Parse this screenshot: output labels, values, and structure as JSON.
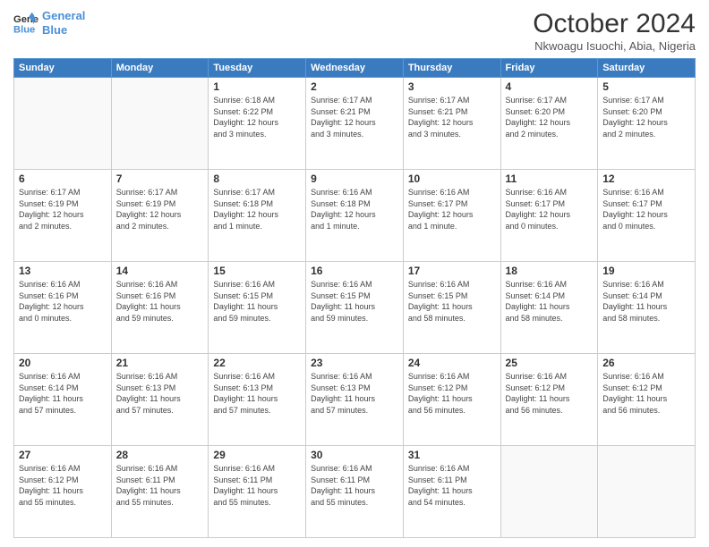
{
  "header": {
    "logo_line1": "General",
    "logo_line2": "Blue",
    "month_title": "October 2024",
    "subtitle": "Nkwoagu Isuochi, Abia, Nigeria"
  },
  "weekdays": [
    "Sunday",
    "Monday",
    "Tuesday",
    "Wednesday",
    "Thursday",
    "Friday",
    "Saturday"
  ],
  "weeks": [
    [
      {
        "day": "",
        "info": ""
      },
      {
        "day": "",
        "info": ""
      },
      {
        "day": "1",
        "info": "Sunrise: 6:18 AM\nSunset: 6:22 PM\nDaylight: 12 hours\nand 3 minutes."
      },
      {
        "day": "2",
        "info": "Sunrise: 6:17 AM\nSunset: 6:21 PM\nDaylight: 12 hours\nand 3 minutes."
      },
      {
        "day": "3",
        "info": "Sunrise: 6:17 AM\nSunset: 6:21 PM\nDaylight: 12 hours\nand 3 minutes."
      },
      {
        "day": "4",
        "info": "Sunrise: 6:17 AM\nSunset: 6:20 PM\nDaylight: 12 hours\nand 2 minutes."
      },
      {
        "day": "5",
        "info": "Sunrise: 6:17 AM\nSunset: 6:20 PM\nDaylight: 12 hours\nand 2 minutes."
      }
    ],
    [
      {
        "day": "6",
        "info": "Sunrise: 6:17 AM\nSunset: 6:19 PM\nDaylight: 12 hours\nand 2 minutes."
      },
      {
        "day": "7",
        "info": "Sunrise: 6:17 AM\nSunset: 6:19 PM\nDaylight: 12 hours\nand 2 minutes."
      },
      {
        "day": "8",
        "info": "Sunrise: 6:17 AM\nSunset: 6:18 PM\nDaylight: 12 hours\nand 1 minute."
      },
      {
        "day": "9",
        "info": "Sunrise: 6:16 AM\nSunset: 6:18 PM\nDaylight: 12 hours\nand 1 minute."
      },
      {
        "day": "10",
        "info": "Sunrise: 6:16 AM\nSunset: 6:17 PM\nDaylight: 12 hours\nand 1 minute."
      },
      {
        "day": "11",
        "info": "Sunrise: 6:16 AM\nSunset: 6:17 PM\nDaylight: 12 hours\nand 0 minutes."
      },
      {
        "day": "12",
        "info": "Sunrise: 6:16 AM\nSunset: 6:17 PM\nDaylight: 12 hours\nand 0 minutes."
      }
    ],
    [
      {
        "day": "13",
        "info": "Sunrise: 6:16 AM\nSunset: 6:16 PM\nDaylight: 12 hours\nand 0 minutes."
      },
      {
        "day": "14",
        "info": "Sunrise: 6:16 AM\nSunset: 6:16 PM\nDaylight: 11 hours\nand 59 minutes."
      },
      {
        "day": "15",
        "info": "Sunrise: 6:16 AM\nSunset: 6:15 PM\nDaylight: 11 hours\nand 59 minutes."
      },
      {
        "day": "16",
        "info": "Sunrise: 6:16 AM\nSunset: 6:15 PM\nDaylight: 11 hours\nand 59 minutes."
      },
      {
        "day": "17",
        "info": "Sunrise: 6:16 AM\nSunset: 6:15 PM\nDaylight: 11 hours\nand 58 minutes."
      },
      {
        "day": "18",
        "info": "Sunrise: 6:16 AM\nSunset: 6:14 PM\nDaylight: 11 hours\nand 58 minutes."
      },
      {
        "day": "19",
        "info": "Sunrise: 6:16 AM\nSunset: 6:14 PM\nDaylight: 11 hours\nand 58 minutes."
      }
    ],
    [
      {
        "day": "20",
        "info": "Sunrise: 6:16 AM\nSunset: 6:14 PM\nDaylight: 11 hours\nand 57 minutes."
      },
      {
        "day": "21",
        "info": "Sunrise: 6:16 AM\nSunset: 6:13 PM\nDaylight: 11 hours\nand 57 minutes."
      },
      {
        "day": "22",
        "info": "Sunrise: 6:16 AM\nSunset: 6:13 PM\nDaylight: 11 hours\nand 57 minutes."
      },
      {
        "day": "23",
        "info": "Sunrise: 6:16 AM\nSunset: 6:13 PM\nDaylight: 11 hours\nand 57 minutes."
      },
      {
        "day": "24",
        "info": "Sunrise: 6:16 AM\nSunset: 6:12 PM\nDaylight: 11 hours\nand 56 minutes."
      },
      {
        "day": "25",
        "info": "Sunrise: 6:16 AM\nSunset: 6:12 PM\nDaylight: 11 hours\nand 56 minutes."
      },
      {
        "day": "26",
        "info": "Sunrise: 6:16 AM\nSunset: 6:12 PM\nDaylight: 11 hours\nand 56 minutes."
      }
    ],
    [
      {
        "day": "27",
        "info": "Sunrise: 6:16 AM\nSunset: 6:12 PM\nDaylight: 11 hours\nand 55 minutes."
      },
      {
        "day": "28",
        "info": "Sunrise: 6:16 AM\nSunset: 6:11 PM\nDaylight: 11 hours\nand 55 minutes."
      },
      {
        "day": "29",
        "info": "Sunrise: 6:16 AM\nSunset: 6:11 PM\nDaylight: 11 hours\nand 55 minutes."
      },
      {
        "day": "30",
        "info": "Sunrise: 6:16 AM\nSunset: 6:11 PM\nDaylight: 11 hours\nand 55 minutes."
      },
      {
        "day": "31",
        "info": "Sunrise: 6:16 AM\nSunset: 6:11 PM\nDaylight: 11 hours\nand 54 minutes."
      },
      {
        "day": "",
        "info": ""
      },
      {
        "day": "",
        "info": ""
      }
    ]
  ]
}
